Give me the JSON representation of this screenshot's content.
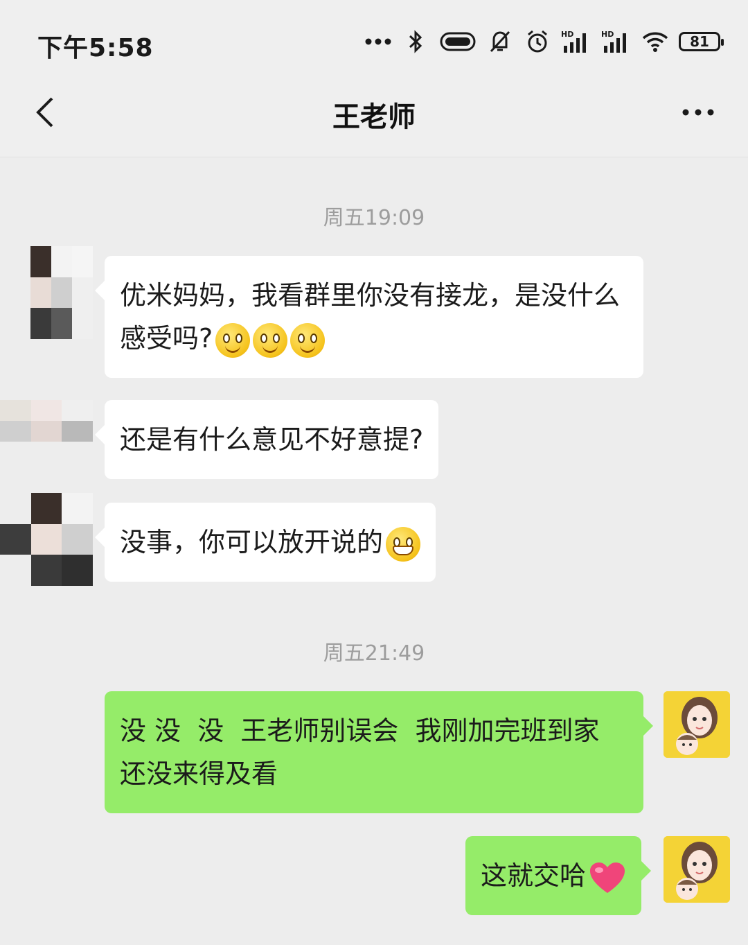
{
  "status_bar": {
    "time": "下午5:58",
    "battery": "81",
    "icons": [
      "more-dots-icon",
      "bluetooth-icon",
      "toggle-icon",
      "bell-muted-icon",
      "alarm-icon",
      "signal-hd-icon",
      "signal-hd-icon",
      "wifi-icon",
      "battery-icon"
    ]
  },
  "nav": {
    "back_icon": "chevron-left-icon",
    "title": "王老师",
    "more_icon": "more-horizontal-icon"
  },
  "chat": {
    "timestamps": [
      "周五19:09",
      "周五21:49"
    ],
    "messages": [
      {
        "side": "left",
        "text": "优米妈妈，我看群里你没有接龙，是没什么感受吗?",
        "emojis": [
          "smile-emoji",
          "smile-emoji",
          "smile-emoji"
        ]
      },
      {
        "side": "left",
        "text": "还是有什么意见不好意提?"
      },
      {
        "side": "left",
        "text": "没事，你可以放开说的",
        "emojis": [
          "grin-emoji"
        ]
      },
      {
        "side": "right",
        "text": "没 没  没  王老师别误会  我刚加完班到家 还没来得及看"
      },
      {
        "side": "right",
        "text": "这就交哈",
        "emojis": [
          "heart-emoji"
        ]
      }
    ]
  },
  "colors": {
    "background": "#ededed",
    "bubble_left": "#ffffff",
    "bubble_right": "#95ec69",
    "timestamp": "#9d9d9d"
  }
}
